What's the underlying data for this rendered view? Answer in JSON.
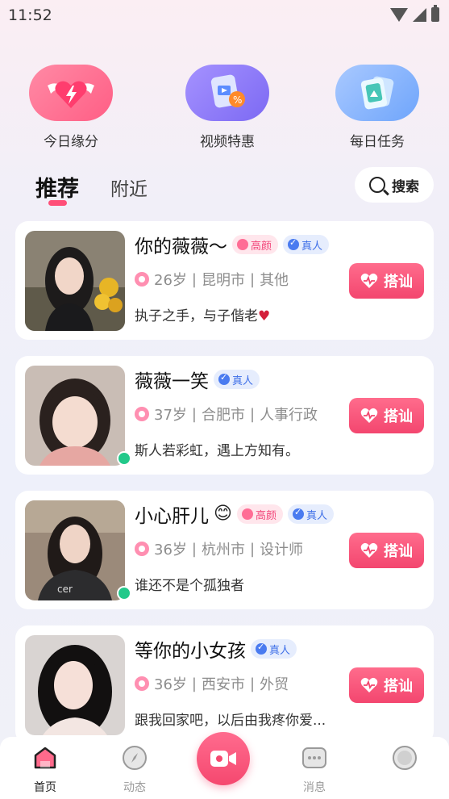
{
  "status_bar": {
    "time": "11:52"
  },
  "quick_actions": [
    {
      "label": "今日缘分",
      "icon": "winged-heart-icon"
    },
    {
      "label": "视频特惠",
      "icon": "video-discount-icon"
    },
    {
      "label": "每日任务",
      "icon": "photo-cards-icon"
    }
  ],
  "tabs": {
    "recommend": "推荐",
    "nearby": "附近"
  },
  "search": {
    "label": "搜索"
  },
  "cards": [
    {
      "name": "你的薇薇～",
      "badges": {
        "looks": "高颜",
        "real": "真人"
      },
      "age": "26岁",
      "city": "昆明市",
      "job": "其他",
      "bio": "执子之手，与子偕老",
      "online": false,
      "action": "搭讪"
    },
    {
      "name": "薇薇一笑",
      "badges": {
        "real": "真人"
      },
      "age": "37岁",
      "city": "合肥市",
      "job": "人事行政",
      "bio": "斯人若彩虹，遇上方知有。",
      "online": true,
      "action": "搭讪"
    },
    {
      "name": "小心肝儿",
      "badges": {
        "looks": "高颜",
        "real": "真人"
      },
      "age": "36岁",
      "city": "杭州市",
      "job": "设计师",
      "bio": "谁还不是个孤独者",
      "online": true,
      "action": "搭讪"
    },
    {
      "name": "等你的小女孩",
      "badges": {
        "real": "真人"
      },
      "age": "36岁",
      "city": "西安市",
      "job": "外贸",
      "bio": "跟我回家吧，以后由我疼你爱...",
      "online": false,
      "action": "搭讪"
    }
  ],
  "separator": "|",
  "bottom_nav": {
    "home": "首页",
    "moments": "动态",
    "messages": "消息"
  },
  "colors": {
    "accent": "#f5486f",
    "online": "#22c98a",
    "real_badge": "#4a7bf0"
  }
}
